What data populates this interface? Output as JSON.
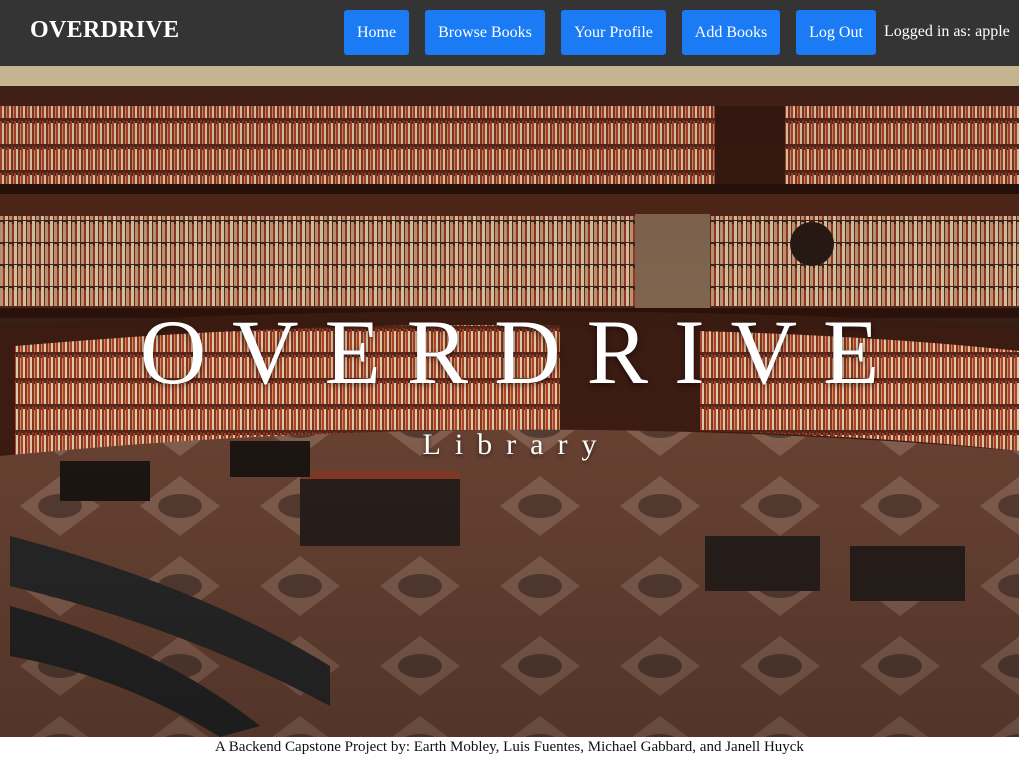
{
  "navbar": {
    "brand": "OVERDRIVE",
    "links": {
      "home": "Home",
      "browse": "Browse Books",
      "profile": "Your Profile",
      "add": "Add Books",
      "logout": "Log Out"
    },
    "login_status": "Logged in as: apple",
    "colors": {
      "background": "#343434",
      "button": "#1b7bf5"
    }
  },
  "hero": {
    "title": "OVERDRIVE",
    "subtitle": "Library",
    "image": "library-rotunda-photo"
  },
  "footer": {
    "credits": "A Backend Capstone Project by: Earth Mobley, Luis Fuentes, Michael Gabbard, and Janell Huyck"
  }
}
